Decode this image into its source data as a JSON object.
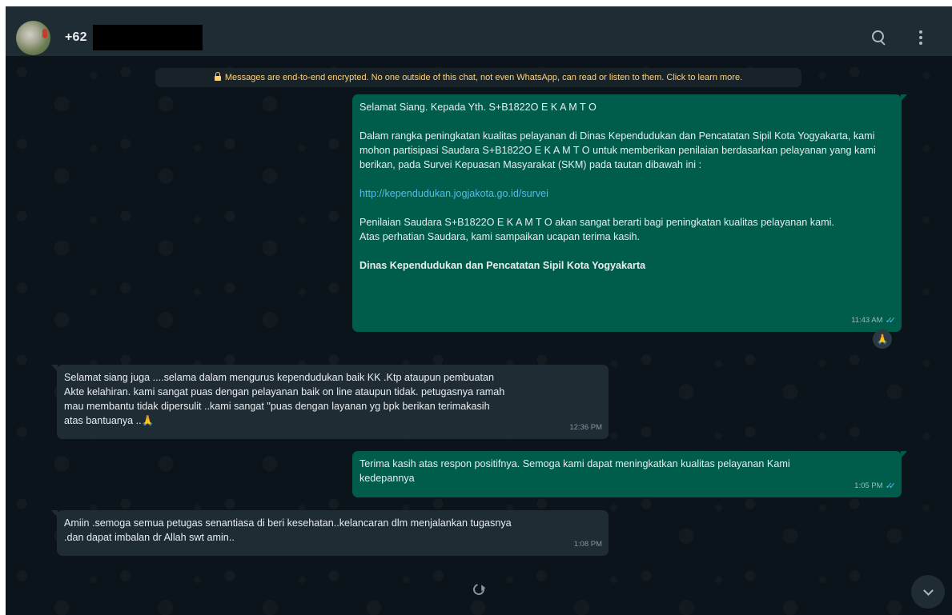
{
  "header": {
    "contact_name": "+62",
    "search_icon": "search-icon",
    "menu_icon": "kebab-menu-icon"
  },
  "encryption_notice": "Messages are end-to-end encrypted. No one outside of this chat, not even WhatsApp, can read or listen to them. Click to learn more.",
  "messages": [
    {
      "direction": "outgoing",
      "greeting": "Selamat Siang. Kepada Yth. S+B1822O E K A M T O",
      "body": "Dalam rangka peningkatan kualitas pelayanan di Dinas Kependudukan dan Pencatatan Sipil Kota Yogyakarta, kami mohon partisipasi Saudara S+B1822O E K A M T O untuk memberikan penilaian berdasarkan pelayanan yang kami berikan, pada Survei Kepuasan Masyarakat (SKM) pada tautan dibawah ini :",
      "link": "http://kependudukan.jogjakota.go.id/survei",
      "closing_1": "Penilaian Saudara S+B1822O E K A M T O akan sangat berarti bagi peningkatan kualitas pelayanan kami.",
      "closing_2": "Atas perhatian Saudara, kami sampaikan ucapan terima kasih.",
      "signature": "Dinas Kependudukan dan Pencatatan Sipil Kota Yogyakarta",
      "time": "11:43 AM",
      "status": "read",
      "reaction": "🙏"
    },
    {
      "direction": "incoming",
      "text_line_1": "Selamat siang juga ....selama dalam mengurus kependudukan baik KK .Ktp ataupun pembuatan",
      "text_line_2": "Akte kelahiran. kami sangat puas dengan pelayanan baik on line ataupun tidak. petugasnya ramah",
      "text_line_3": "mau membantu tidak dipersulit ..kami sangat \"puas dengan layanan yg bpk berikan  terimakasih",
      "text_line_4": "atas bantuanya ..🙏",
      "time": "12:36 PM"
    },
    {
      "direction": "outgoing",
      "text_line_1": "Terima kasih atas respon positifnya. Semoga kami dapat meningkatkan kualitas pelayanan Kami",
      "text_line_2": "kedepannya",
      "time": "1:05 PM",
      "status": "read"
    },
    {
      "direction": "incoming",
      "text_line_1": "Amiin .semoga semua petugas senantiasa di beri kesehatan..kelancaran dlm menjalankan tugasnya",
      "text_line_2": ".dan dapat imbalan dr Allah swt amin..",
      "time": "1:08 PM"
    }
  ],
  "ticks_glyph": "✓✓",
  "colors": {
    "header_bg": "#202c33",
    "chat_bg": "#0b141a",
    "outgoing_bubble": "#005c4b",
    "incoming_bubble": "#202c33",
    "encryption_text": "#ffd279",
    "link": "#53bdeb"
  }
}
